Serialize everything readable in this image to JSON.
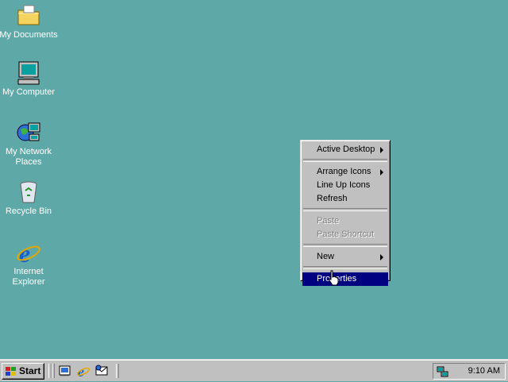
{
  "desktop": {
    "icons": [
      {
        "label": "My Documents"
      },
      {
        "label": "My Computer"
      },
      {
        "label": "My Network Places"
      },
      {
        "label": "Recycle Bin"
      },
      {
        "label": "Internet Explorer"
      }
    ]
  },
  "context_menu": {
    "items": [
      {
        "label": "Active Desktop",
        "submenu": true
      },
      {
        "label": "Arrange Icons",
        "submenu": true
      },
      {
        "label": "Line Up Icons"
      },
      {
        "label": "Refresh"
      },
      {
        "label": "Paste",
        "disabled": true
      },
      {
        "label": "Paste Shortcut",
        "disabled": true
      },
      {
        "label": "New",
        "submenu": true
      },
      {
        "label": "Properties",
        "selected": true
      }
    ]
  },
  "taskbar": {
    "start_label": "Start",
    "clock": "9:10 AM"
  },
  "colors": {
    "desktop": "#5fa8a8",
    "menu_face": "#c0c0c0",
    "highlight": "#000080"
  }
}
